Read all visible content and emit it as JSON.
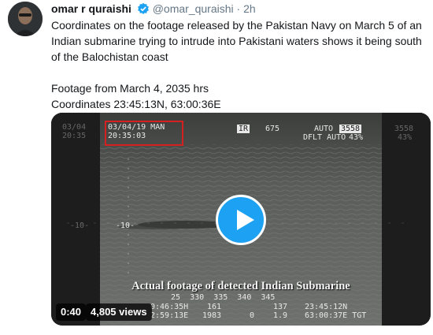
{
  "tweet": {
    "author_name": "omar r quraishi",
    "handle": "@omar_quraishi",
    "separator": "·",
    "time": "2h",
    "text_line1": "Coordinates on the footage released by the Pakistan Navy on March 5 of an Indian submarine trying to intrude into Pakistani waters shows it being south of the Balochistan coast",
    "text_line2": "Footage from March 4, 2035 hrs",
    "text_line3": "Coordinates 23:45:13N, 63:00:36E",
    "verified_icon": "verified-badge-icon"
  },
  "video": {
    "caption": "Actual  footage of detected Indian Submarine",
    "duration": "0:40",
    "views": "4,805 views",
    "osd": {
      "date": "03/04/19 MAN",
      "clock": "20:35:03",
      "ir_label": "IR",
      "ir_value": "675",
      "auto_label": "AUTO",
      "auto_value": "3558",
      "dflt_label": "DFLT AUTO",
      "pct": "43%",
      "ghost_top_left1": "03/04",
      "ghost_top_left2": "20:35",
      "ghost_top_right1": "3558",
      "ghost_top_right2": "43%",
      "scale_10a": "-10-",
      "scale_10b": "-10-",
      "bottom_bearing": "25  330  335  340  345",
      "bottom_left1": "0:46:35H",
      "bottom_left2": "2:59:13E",
      "bottom_mid1": "161",
      "bottom_mid2": "1983",
      "bottom_mid3": "0",
      "bottom_r1a": "137",
      "bottom_r1b": "1.9",
      "bottom_r2a": "23:45:12N",
      "bottom_r2b": "63:00:37E TGT"
    }
  },
  "colors": {
    "play_button": "#1da1f2",
    "verified": "#1da1f2",
    "highlight_box": "#d42020"
  }
}
